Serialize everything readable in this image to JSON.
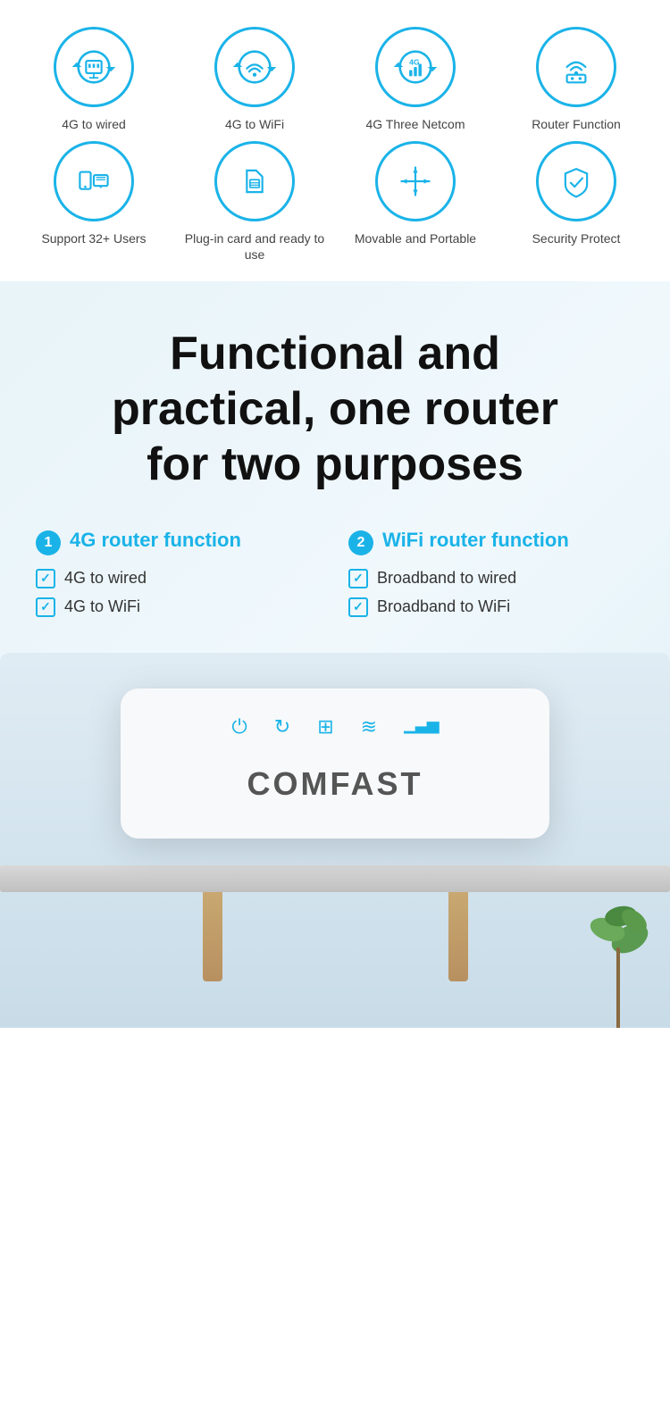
{
  "features_row1": [
    {
      "id": "4g-wired",
      "label": "4G to wired",
      "icon": "ethernet"
    },
    {
      "id": "4g-wifi",
      "label": "4G to WiFi",
      "icon": "wifi"
    },
    {
      "id": "4g-netcom",
      "label": "4G Three Netcom",
      "icon": "4g-signal"
    },
    {
      "id": "router-fn",
      "label": "Router Function",
      "icon": "router"
    }
  ],
  "features_row2": [
    {
      "id": "users",
      "label": "Support 32+ Users",
      "icon": "users"
    },
    {
      "id": "plugin-card",
      "label": "Plug-in card and ready to use",
      "icon": "sim"
    },
    {
      "id": "movable",
      "label": "Movable and Portable",
      "icon": "move"
    },
    {
      "id": "security",
      "label": "Security Protect",
      "icon": "shield"
    }
  ],
  "main_heading_line1": "Functional and",
  "main_heading_line2": "practical, one router",
  "main_heading_line3": "for two purposes",
  "function1": {
    "number": "1",
    "title": "4G router function",
    "items": [
      "4G to wired",
      "4G to WiFi"
    ]
  },
  "function2": {
    "number": "2",
    "title": "WiFi router function",
    "items": [
      "Broadband to wired",
      "Broadband to WiFi"
    ]
  },
  "router_brand": "COMFAST"
}
